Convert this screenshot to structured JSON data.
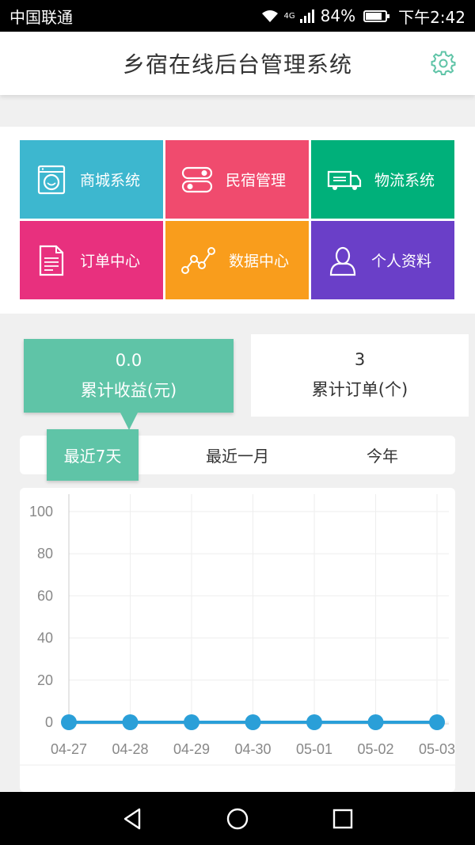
{
  "status_bar": {
    "carrier": "中国联通",
    "network": "4G",
    "battery": "84%",
    "battery_level": 0.84,
    "time": "下午2:42"
  },
  "header": {
    "title": "乡宿在线后台管理系统",
    "settings_icon": "gear-icon"
  },
  "menu": {
    "items": [
      {
        "label": "商城系统",
        "icon": "washer-icon",
        "color": "#3db7cf"
      },
      {
        "label": "民宿管理",
        "icon": "toggle-icon",
        "color": "#f04b6e"
      },
      {
        "label": "物流系统",
        "icon": "truck-icon",
        "color": "#00b07a"
      },
      {
        "label": "订单中心",
        "icon": "document-icon",
        "color": "#e8307e"
      },
      {
        "label": "数据中心",
        "icon": "graph-icon",
        "color": "#f99d1c"
      },
      {
        "label": "个人资料",
        "icon": "person-icon",
        "color": "#6a3fc8"
      }
    ]
  },
  "stats": {
    "revenue": {
      "value": "0.0",
      "label": "累计收益(元)"
    },
    "orders": {
      "value": "3",
      "label": "累计订单(个)"
    }
  },
  "range_tabs": {
    "tabs": [
      "最近7天",
      "最近一月",
      "今年"
    ],
    "selected": 0
  },
  "accent_color": "#5fc4a7",
  "chart_data": {
    "type": "line",
    "categories": [
      "04-27",
      "04-28",
      "04-29",
      "04-30",
      "05-01",
      "05-02",
      "05-03"
    ],
    "series": [
      {
        "values": [
          0,
          0,
          0,
          0,
          0,
          0,
          0
        ]
      }
    ],
    "ylim": [
      0,
      100
    ],
    "yticks": [
      0,
      20,
      40,
      60,
      80,
      100
    ],
    "grid": true,
    "color": "#2a9fd8"
  },
  "nav_bar": {
    "back_icon": "back-triangle-icon",
    "home_icon": "home-circle-icon",
    "recents_icon": "recents-square-icon"
  }
}
